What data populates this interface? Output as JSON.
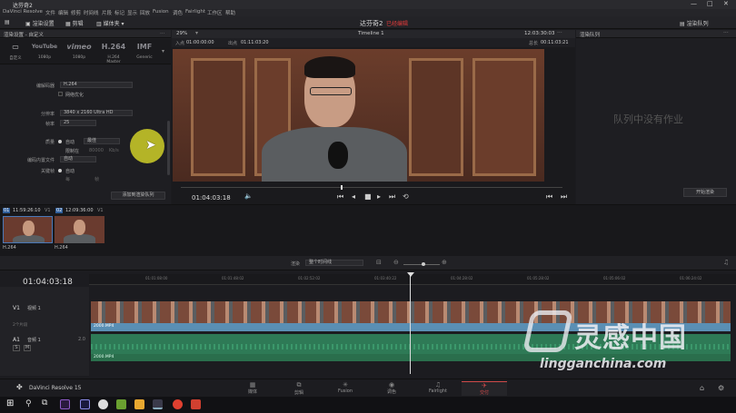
{
  "window": {
    "title": "达芬奇2",
    "controls": [
      "—",
      "□",
      "✕"
    ]
  },
  "menu": [
    "DaVinci Resolve",
    "文件",
    "编辑",
    "修剪",
    "时间线",
    "片段",
    "标记",
    "显示",
    "回放",
    "Fusion",
    "调色",
    "Fairlight",
    "工作区",
    "帮助"
  ],
  "toolbar": {
    "render_settings": "渲染设置",
    "clips": "剪辑",
    "bin": "媒体夹",
    "project_name": "达芬奇2",
    "project_status": "已经编辑",
    "render_queue": "渲染队列"
  },
  "render_panel": {
    "header": "渲染设置 - 自定义",
    "presets": [
      {
        "logo": "▭",
        "label": "自定义"
      },
      {
        "logo": "YouTube",
        "label": "1080p"
      },
      {
        "logo": "vimeo",
        "label": "1080p"
      },
      {
        "logo": "H.264",
        "label": "H.264 Master"
      },
      {
        "logo": "IMF",
        "label": "Generic"
      }
    ],
    "codec_label": "编解码器",
    "codec_value": "H.264",
    "network_opt": "网络优化",
    "resolution_label": "分辨率",
    "resolution_value": "3840 x 2160 Ultra HD",
    "framerate_label": "帧率",
    "framerate_value": "25",
    "quality_label": "质量",
    "quality_auto": "自动",
    "quality_value": "最佳",
    "limit_label": "限制在",
    "limit_value": "80000",
    "limit_unit": "Kb/s",
    "keyframe_label": "编码内置文件",
    "keyframe_value": "自动",
    "frame_reorder": "关键帧",
    "auto_label": "自动",
    "every_label": "每",
    "frames_label": "帧",
    "add_to_queue": "添加到渲染队列"
  },
  "viewer": {
    "zoom": "29%",
    "in_label": "入点",
    "in_tc": "01:00:00:00",
    "out_label": "出点",
    "out_tc": "01:11:03:20",
    "timeline_name": "Timeline 1",
    "duration_tc": "12:03:30:03",
    "total_label": "总长",
    "total_tc": "00:11:03:21",
    "current_tc": "01:04:03:18",
    "playhead_fraction": 0.42
  },
  "queue": {
    "header": "渲染队列",
    "empty_text": "队列中没有作业",
    "start_render": "开始渲染"
  },
  "clips": [
    {
      "index": "01",
      "tc": "11:59:26:10",
      "track": "V1",
      "codec": "H.264"
    },
    {
      "index": "02",
      "tc": "12:09:36:00",
      "track": "V1",
      "codec": "H.264"
    }
  ],
  "timeline": {
    "current_tc": "01:04:03:18",
    "render_mode_label": "渲染",
    "render_mode_value": "整个时间线",
    "ruler_ticks": [
      "01:01:08:00",
      "01:01:48:02",
      "01:02:52:02",
      "01:03:40:22",
      "01:04:28:02",
      "01:05:28:02",
      "01:05:06:02",
      "01:06:24:02"
    ],
    "v1_label": "V1",
    "v1_name": "视频 1",
    "v1_clip_count": "2个片段",
    "v1_clip_name": "2000.MP4",
    "a1_label": "A1",
    "a1_name": "音频 1",
    "a1_channel": "2.0",
    "a1_clip_name": "2000.MP4",
    "a1_s": "S",
    "a1_m": "M"
  },
  "page_nav": {
    "app_name": "DaVinci Resolve 15",
    "tabs": [
      {
        "key": "media",
        "icon": "▦",
        "label": "媒体"
      },
      {
        "key": "edit",
        "icon": "⧉",
        "label": "剪辑"
      },
      {
        "key": "fusion",
        "icon": "✳",
        "label": "Fusion"
      },
      {
        "key": "color",
        "icon": "◉",
        "label": "调色"
      },
      {
        "key": "fairlight",
        "icon": "♫",
        "label": "Fairlight"
      },
      {
        "key": "deliver",
        "icon": "✈",
        "label": "交付"
      }
    ]
  },
  "watermark": {
    "cn": "灵感中国",
    "en": "lingganchina.com"
  },
  "colors": {
    "accent_red": "#e23b3b",
    "video_track": "#5a8fb4",
    "audio_track": "#2e7a56",
    "cursor_highlight": "#d6d628"
  }
}
